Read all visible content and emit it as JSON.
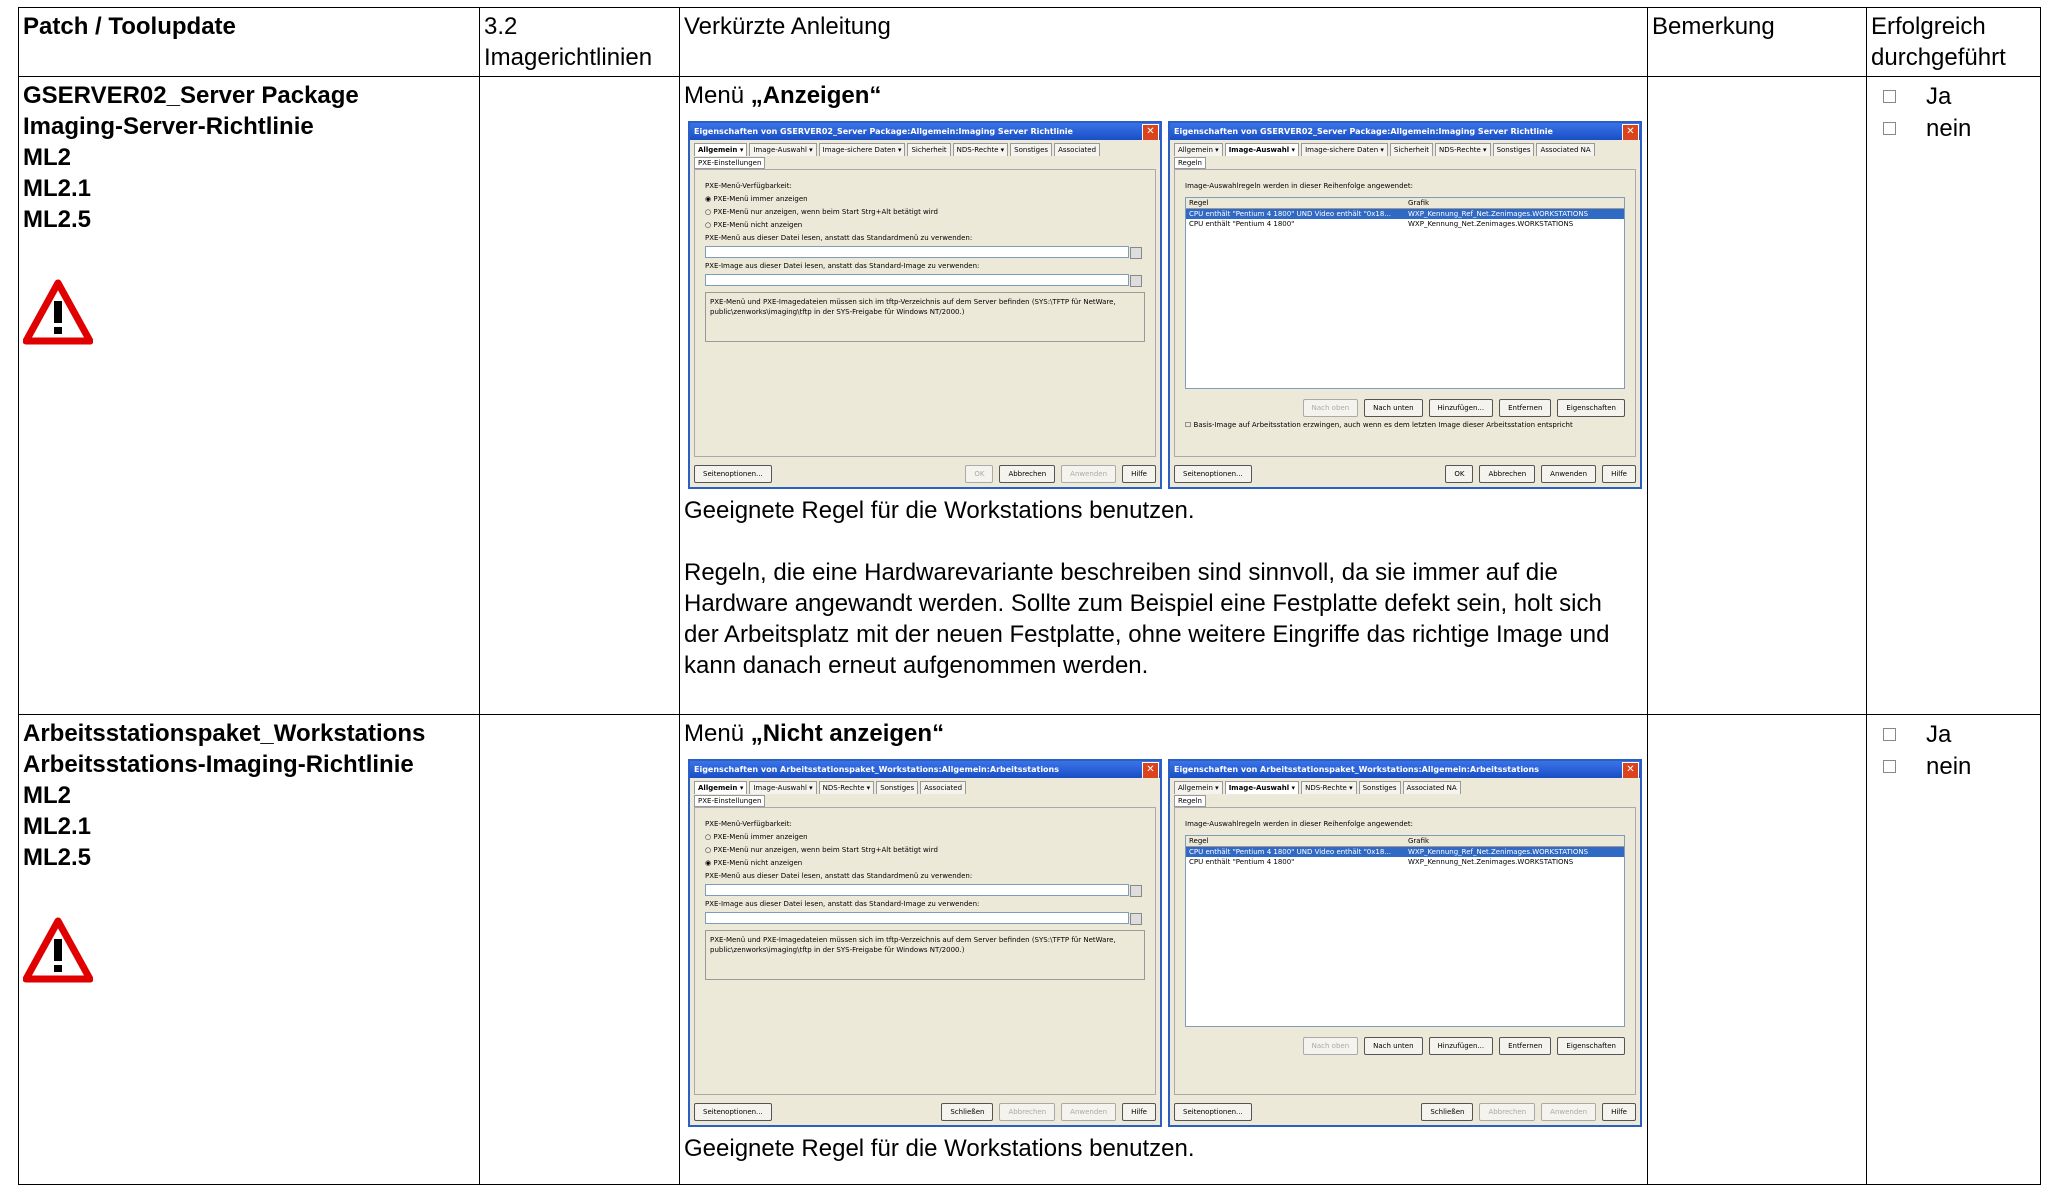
{
  "headers": {
    "patch": "Patch / Toolupdate",
    "ref": "3.2 Imagerichtlinien",
    "instr": "Verkürzte Anleitung",
    "remark": "Bemerkung",
    "done": "Erfolgreich durchgeführt"
  },
  "check": {
    "ja": "Ja",
    "nein": "nein"
  },
  "rows": [
    {
      "patch": [
        "GSERVER02_Server Package",
        "Imaging-Server-Richtlinie",
        "ML2",
        "ML2.1",
        "ML2.5"
      ],
      "menu_prefix": "Menü ",
      "menu_bold": "„Anzeigen“",
      "text1": "Geeignete Regel für die Workstations benutzen.",
      "text2": "Regeln, die eine Hardwarevariante beschreiben sind sinnvoll, da sie immer auf die Hardware angewandt werden. Sollte zum Beispiel eine Festplatte defekt sein, holt sich der Arbeitsplatz mit der neuen Festplatte, ohne weitere Eingriffe das richtige Image und kann danach erneut aufgenommen werden.",
      "dlg_title": "Eigenschaften von GSERVER02_Server Package:Allgemein:Imaging Server Richtlinie"
    },
    {
      "patch": [
        "Arbeitsstationspaket_Workstations",
        "Arbeitsstations-Imaging-Richtlinie",
        "ML2",
        "ML2.1",
        "ML2.5"
      ],
      "menu_prefix": "Menü ",
      "menu_bold": "„Nicht anzeigen“",
      "text1": "Geeignete Regel für die Workstations benutzen.",
      "dlg_title": "Eigenschaften von Arbeitsstationspaket_Workstations:Allgemein:Arbeitsstations"
    }
  ],
  "dlg": {
    "tabs_left": [
      "Allgemein ▾",
      "Image-Auswahl ▾",
      "Image-sichere Daten ▾",
      "Sicherheit",
      "NDS-Rechte ▾",
      "Sonstiges",
      "Associated"
    ],
    "tabs_right": [
      "Allgemein ▾",
      "Image-Auswahl ▾",
      "Image-sichere Daten ▾",
      "Sicherheit",
      "NDS-Rechte ▾",
      "Sonstiges",
      "Associated NA"
    ],
    "sub_left": "PXE-Einstellungen",
    "sub_right": "Regeln",
    "pxe_label": "PXE-Menü-Verfügbarkeit:",
    "opt1": "PXE-Menü immer anzeigen",
    "opt2": "PXE-Menü nur anzeigen, wenn beim Start Strg+Alt betätigt wird",
    "opt3": "PXE-Menü nicht anzeigen",
    "menu_file": "PXE-Menü aus dieser Datei lesen, anstatt das Standardmenü zu verwenden:",
    "image_file": "PXE-Image aus dieser Datei lesen, anstatt das Standard-Image zu verwenden:",
    "note": "PXE-Menü und PXE-Imagedateien müssen sich im tftp-Verzeichnis auf dem Server befinden (SYS:\\TFTP für NetWare, public\\zenworks\\imaging\\tftp in der SYS-Freigabe für Windows NT/2000.)",
    "rules_label": "Image-Auswahlregeln werden in dieser Reihenfolge angewendet:",
    "col_rule": "Regel",
    "col_graphic": "Grafik",
    "rule1": "CPU enthält \"Pentium 4 1800\" UND Video enthält \"0x18...",
    "graphic1": "WXP_Kennung_Ref_Net.Zenimages.WORKSTATIONS",
    "rule2": "CPU enthält \"Pentium 4 1800\"",
    "graphic2": "WXP_Kennung_Net.Zenimages.WORKSTATIONS",
    "b_up": "Nach oben",
    "b_down": "Nach unten",
    "b_add": "Hinzufügen...",
    "b_remove": "Entfernen",
    "b_props": "Eigenschaften",
    "force": "Basis-Image auf Arbeitsstation erzwingen, auch wenn es dem letzten Image dieser Arbeitsstation entspricht",
    "pageopts": "Seitenoptionen...",
    "ok": "OK",
    "close": "Schließen",
    "cancel": "Abbrechen",
    "apply": "Anwenden",
    "help": "Hilfe"
  }
}
